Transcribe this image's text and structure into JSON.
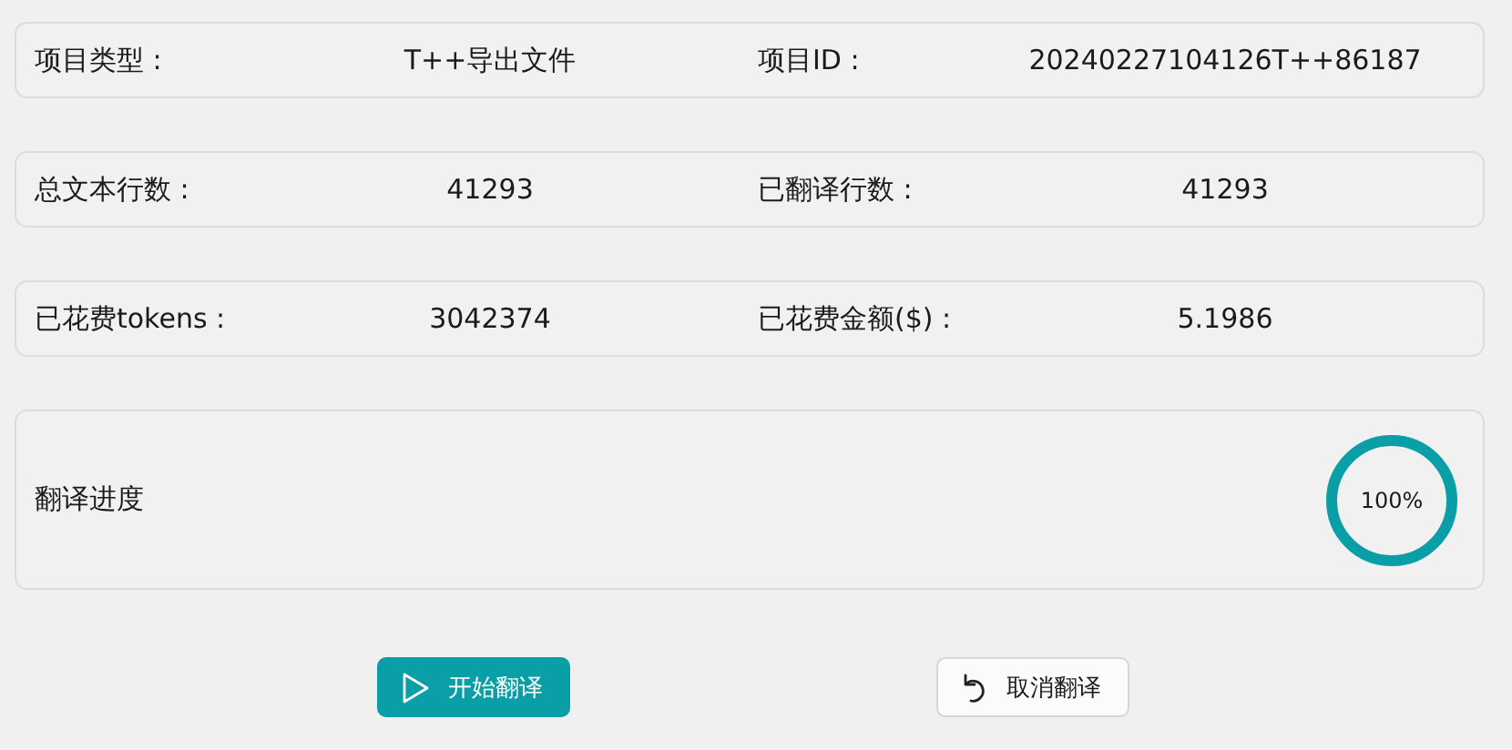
{
  "info_rows": [
    {
      "fields": [
        {
          "label": "项目类型 :",
          "value": "T++导出文件"
        },
        {
          "label": "项目ID :",
          "value": "20240227104126T++86187"
        }
      ]
    },
    {
      "fields": [
        {
          "label": "总文本行数 :",
          "value": "41293"
        },
        {
          "label": "已翻译行数 :",
          "value": "41293"
        }
      ]
    },
    {
      "fields": [
        {
          "label": "已花费tokens :",
          "value": "3042374"
        },
        {
          "label": "已花费金额($) :",
          "value": "5.1986"
        }
      ]
    }
  ],
  "progress": {
    "label": "翻译进度",
    "reading": "100%",
    "level": 1
  },
  "buttons": [
    {
      "kind": "primary",
      "label": "开始翻译"
    },
    {
      "kind": "secondary",
      "label": "取消翻译"
    }
  ]
}
